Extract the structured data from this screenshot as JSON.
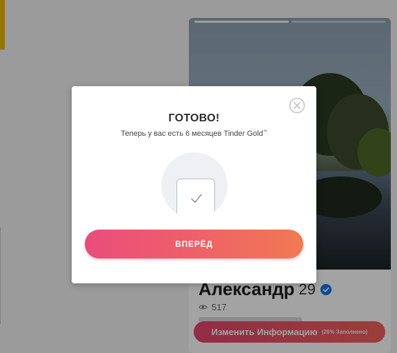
{
  "modal": {
    "title": "ГОТОВО!",
    "subtitle": "Теперь у вас есть 6 месяцев Tinder Gold",
    "subtitle_mark": "™",
    "forward_button": "ВПЕРЁД"
  },
  "profile": {
    "name": "Александр",
    "age": "29",
    "views": "517",
    "edit_button": "Изменить Информацию",
    "edit_progress": "(26% Заполнено)"
  },
  "colors": {
    "accent_gradient_start": "#ea4c7c",
    "accent_gradient_end": "#f07a52",
    "verified_blue": "#1a73e8"
  },
  "icons": {
    "close": "close-circle-icon",
    "check": "checkmark-icon",
    "verified": "verified-badge-icon",
    "views": "eye-icon"
  }
}
